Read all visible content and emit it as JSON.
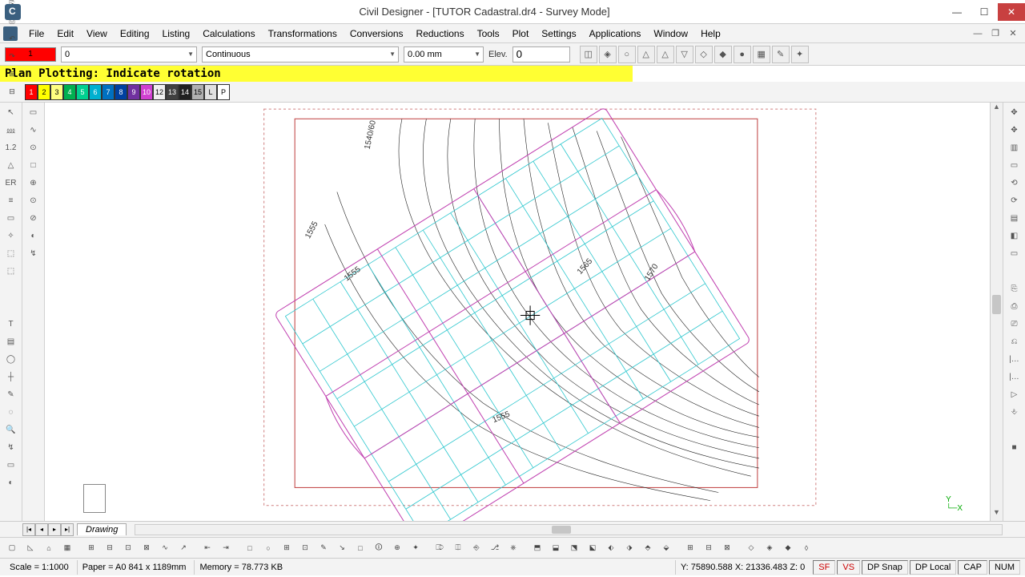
{
  "title": "Civil Designer - [TUTOR Cadastral.dr4 - Survey Mode]",
  "menu": [
    "File",
    "Edit",
    "View",
    "Editing",
    "Listing",
    "Calculations",
    "Transformations",
    "Conversions",
    "Reductions",
    "Tools",
    "Plot",
    "Settings",
    "Applications",
    "Window",
    "Help"
  ],
  "props": {
    "color_label": "1",
    "layer": "0",
    "linetype": "Continuous",
    "lineweight": "0.00 mm",
    "elev_label": "Elev.",
    "elev_value": "0"
  },
  "prompt": "Plan Plotting: Indicate rotation",
  "palette": [
    {
      "n": "1",
      "c": "#ff0000"
    },
    {
      "n": "2",
      "c": "#ffff00"
    },
    {
      "n": "3",
      "c": "#ffff80"
    },
    {
      "n": "4",
      "c": "#00b050"
    },
    {
      "n": "5",
      "c": "#00d090"
    },
    {
      "n": "6",
      "c": "#00b0d0"
    },
    {
      "n": "7",
      "c": "#0070c0"
    },
    {
      "n": "8",
      "c": "#0040a0"
    },
    {
      "n": "9",
      "c": "#7030a0"
    },
    {
      "n": "10",
      "c": "#d040d0"
    },
    {
      "n": "12",
      "c": "#f0f0f0"
    },
    {
      "n": "13",
      "c": "#404040"
    },
    {
      "n": "14",
      "c": "#202020"
    },
    {
      "n": "15",
      "c": "#b0b0b0"
    },
    {
      "n": "L",
      "c": "#e0e0e0"
    },
    {
      "n": "P",
      "c": "#ffffff"
    }
  ],
  "sheet_tab": "Drawing",
  "contour_labels": [
    "1540/60",
    "1555",
    "1555",
    "1555",
    "1565",
    "1570"
  ],
  "compass": {
    "y": "Y",
    "x": "X"
  },
  "status": {
    "scale": "Scale = 1:1000",
    "paper": "Paper = A0 841 x 1189mm",
    "memory": "Memory = 78.773 KB",
    "coords": "Y: 75890.588 X: 21336.483 Z: 0",
    "toggles": [
      "SF",
      "VS",
      "DP Snap",
      "DP Local",
      "CAP",
      "NUM"
    ]
  }
}
